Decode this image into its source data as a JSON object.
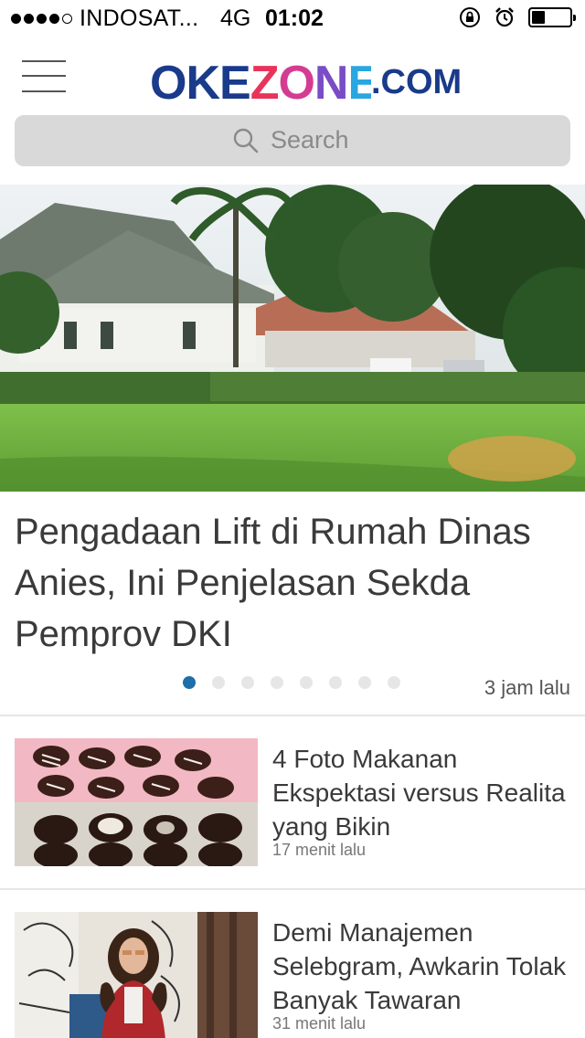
{
  "status_bar": {
    "carrier": "INDOSAT...",
    "network": "4G",
    "time": "01:02",
    "battery_level": 0.35
  },
  "header": {
    "logo_main": "OKEZONE",
    "logo_suffix": ".COM"
  },
  "search": {
    "placeholder": "Search"
  },
  "hero": {
    "headline": "Pengadaan Lift di Rumah Dinas Anies, Ini Penjelasan Sekda Pemprov DKI",
    "time": "3 jam lalu",
    "slide_count": 8,
    "active_slide": 1
  },
  "articles": [
    {
      "title": "4 Foto Makanan Ekspektasi versus Realita yang Bikin",
      "time": "17 menit lalu"
    },
    {
      "title": "Demi Manajemen Selebgram, Awkarin Tolak Banyak Tawaran",
      "time": "31 menit lalu"
    }
  ],
  "colors": {
    "accent": "#1c6fa8",
    "logo_blue": "#1a3a8a",
    "search_bg": "#d9d9d9"
  }
}
